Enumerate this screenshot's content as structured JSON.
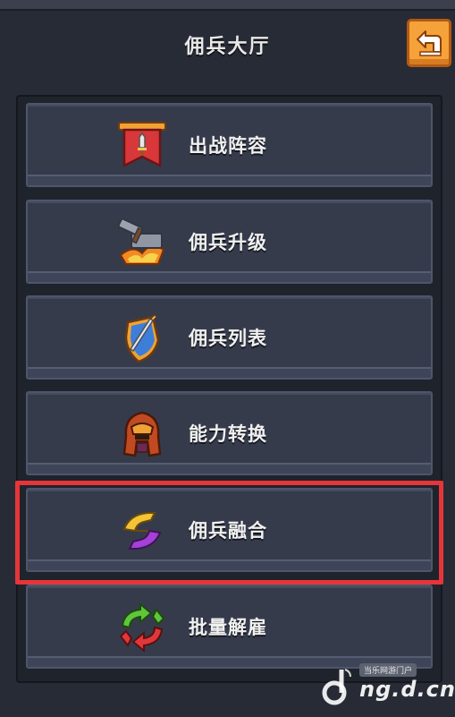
{
  "header": {
    "title": "佣兵大厅"
  },
  "back_button": {
    "icon": "back-arrow-icon",
    "color": "#f6a23a"
  },
  "menu": [
    {
      "label": "出战阵容",
      "icon": "banner-sword-icon"
    },
    {
      "label": "佣兵升级",
      "icon": "hammer-anvil-icon"
    },
    {
      "label": "佣兵列表",
      "icon": "shield-sword-icon"
    },
    {
      "label": "能力转换",
      "icon": "helmet-icon"
    },
    {
      "label": "佣兵融合",
      "icon": "fusion-swirl-icon",
      "highlighted": true
    },
    {
      "label": "批量解雇",
      "icon": "recycle-arrows-icon"
    }
  ],
  "highlight_color": "#e63539",
  "watermark": {
    "bubble": "当乐网游门户",
    "text": "ng.d.cn"
  }
}
